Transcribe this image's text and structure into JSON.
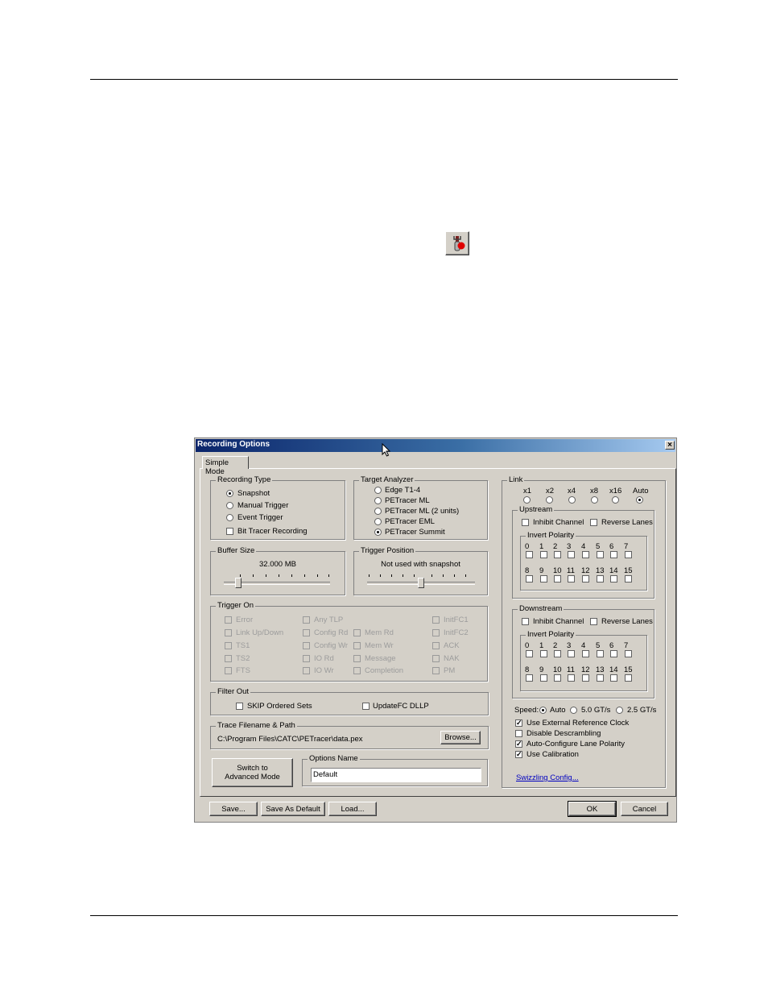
{
  "toolbar_icon": {
    "name": "recording-options-icon"
  },
  "dialog": {
    "title": "Recording Options",
    "close_label": "×",
    "tab": "Simple Mode",
    "recording_type": {
      "legend": "Recording Type",
      "options": [
        "Snapshot",
        "Manual Trigger",
        "Event Trigger"
      ],
      "selected": "Snapshot",
      "bit_tracer": "Bit Tracer Recording"
    },
    "target_analyzer": {
      "legend": "Target Analyzer",
      "options": [
        "Edge T1-4",
        "PETracer ML",
        "PETracer ML (2 units)",
        "PETracer EML",
        "PETracer Summit"
      ],
      "selected": "PETracer Summit"
    },
    "buffer_size": {
      "legend": "Buffer Size",
      "value": "32.000 MB",
      "slider_fraction": 0.1
    },
    "trigger_position": {
      "legend": "Trigger Position",
      "note": "Not used with snapshot",
      "slider_fraction": 0.5
    },
    "trigger_on": {
      "legend": "Trigger On",
      "col1": [
        "Error",
        "Link Up/Down",
        "TS1",
        "TS2",
        "FTS"
      ],
      "col2": [
        "Any TLP",
        "Config Rd",
        "Config Wr",
        "IO Rd",
        "IO Wr"
      ],
      "col3": [
        "Mem Rd",
        "Mem Wr",
        "Message",
        "Completion"
      ],
      "col4": [
        "InitFC1",
        "InitFC2",
        "ACK",
        "NAK",
        "PM"
      ]
    },
    "filter_out": {
      "legend": "Filter Out",
      "skip": "SKIP Ordered Sets",
      "updatefc": "UpdateFC DLLP"
    },
    "trace": {
      "legend": "Trace Filename & Path",
      "path": "C:\\Program Files\\CATC\\PETracer\\data.pex",
      "browse": "Browse..."
    },
    "switch_button": {
      "line1": "Switch to",
      "line2": "Advanced Mode"
    },
    "options_name": {
      "legend": "Options Name",
      "value": "Default"
    },
    "link": {
      "legend": "Link",
      "widths": [
        "x1",
        "x2",
        "x4",
        "x8",
        "x16",
        "Auto"
      ],
      "selected": "Auto",
      "upstream": {
        "legend": "Upstream",
        "inhibit": "Inhibit Channel",
        "reverse": "Reverse Lanes",
        "invert": "Invert Polarity",
        "row1": [
          "0",
          "1",
          "2",
          "3",
          "4",
          "5",
          "6",
          "7"
        ],
        "row2": [
          "8",
          "9",
          "10",
          "11",
          "12",
          "13",
          "14",
          "15"
        ]
      },
      "downstream": {
        "legend": "Downstream",
        "inhibit": "Inhibit Channel",
        "reverse": "Reverse Lanes",
        "invert": "Invert Polarity",
        "row1": [
          "0",
          "1",
          "2",
          "3",
          "4",
          "5",
          "6",
          "7"
        ],
        "row2": [
          "8",
          "9",
          "10",
          "11",
          "12",
          "13",
          "14",
          "15"
        ]
      },
      "speed": {
        "label": "Speed:",
        "options": [
          "Auto",
          "5.0 GT/s",
          "2.5 GT/s"
        ],
        "selected": "Auto"
      },
      "checks": [
        {
          "label": "Use External Reference Clock",
          "checked": true
        },
        {
          "label": "Disable Descrambling",
          "checked": false
        },
        {
          "label": "Auto-Configure Lane Polarity",
          "checked": true
        },
        {
          "label": "Use Calibration",
          "checked": true
        }
      ],
      "swizzling": "Swizzling Config..."
    },
    "buttons": {
      "save": "Save...",
      "save_default": "Save As Default",
      "load": "Load...",
      "ok": "OK",
      "cancel": "Cancel"
    }
  }
}
